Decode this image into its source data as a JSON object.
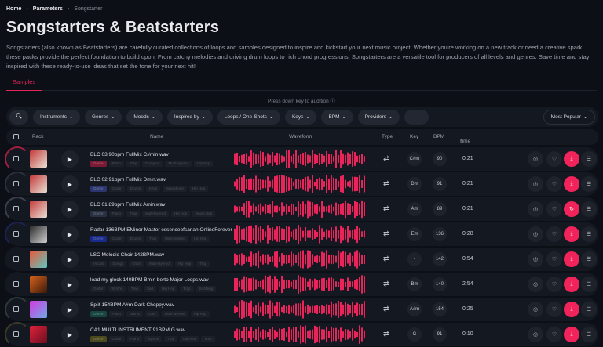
{
  "breadcrumb": [
    "Home",
    "Parameters",
    "Songstarter"
  ],
  "title": "Songstarters & Beatstarters",
  "description": "Songstarters (also known as Beatstarters) are carefully curated collections of loops and samples designed to inspire and kickstart your next music project. Whether you're working on a new track or need a creative spark, these packs provide the perfect foundation to build upon. From catchy melodies and driving drum loops to rich chord progressions, Songstarters are a versatile tool for producers of all levels and genres. Save time and stay inspired with these ready-to-use ideas that set the tone for your next hit!",
  "tabs": [
    {
      "label": "Samples",
      "active": true
    }
  ],
  "hint": "Press down key to audition",
  "filters": [
    "Instruments",
    "Genres",
    "Moods",
    "Inspired by",
    "Loops / One-Shots",
    "Keys",
    "BPM",
    "Providers"
  ],
  "more_label": "···",
  "sort": "Most Popular",
  "columns": {
    "pack": "Pack",
    "name": "Name",
    "waveform": "Waveform",
    "type": "Type",
    "key": "Key",
    "bpm": "BPM",
    "time": "Time"
  },
  "accent": "#f0245b",
  "rows": [
    {
      "name": "BLC 03 90bpm FullMix C#min.wav",
      "tags": [
        "Genre",
        "Piano",
        "Trap",
        "Dungeon",
        "Multi-layered",
        "Hip Hop"
      ],
      "badge_color": "#7a1a34",
      "ring": "#a01e40",
      "key": "C#m",
      "bpm": "90",
      "time": "0:21",
      "art": [
        "#c43a3a",
        "#e8e1d5"
      ],
      "action": "download"
    },
    {
      "name": "BLC 02 91bpm FullMix Dmin.wav",
      "tags": [
        "Genre",
        "Guitar",
        "Drums",
        "Keys",
        "Saxophone",
        "Hip Hop"
      ],
      "badge_color": "#2b3670",
      "ring": "#2a2f3a",
      "key": "Dm",
      "bpm": "91",
      "time": "0:21",
      "art": [
        "#c43a3a",
        "#e8e1d5"
      ],
      "action": "download"
    },
    {
      "name": "BLC 01 89bpm FullMix Amin.wav",
      "tags": [
        "Genre",
        "Piano",
        "Trap",
        "Multi-layered",
        "Hip Hop",
        "Boom Bap"
      ],
      "badge_color": "#283042",
      "ring": "#3a3f4a",
      "key": "Am",
      "bpm": "89",
      "time": "0:21",
      "art": [
        "#c43a3a",
        "#e8e1d5"
      ],
      "action": "replay"
    },
    {
      "name": "Radar 136BPM EMinor Master essenceofsariah OnlineForeverM",
      "tags": [
        "Genre",
        "Guitar",
        "Drums",
        "Trap",
        "Multi-layered",
        "Hip Hop"
      ],
      "badge_color": "#1a2a8a",
      "ring": "#1b2250",
      "key": "Em",
      "bpm": "136",
      "time": "0:28",
      "art": [
        "#2a2a2a",
        "#cfcfcf"
      ],
      "action": "download"
    },
    {
      "name": "LSC Melodic Choir 142BPM.wav",
      "tags": [
        "Vocals",
        "Strings",
        "Choir",
        "Multi-layered",
        "Hip Hop",
        "Trap"
      ],
      "badge_color": "#1c2029",
      "ring": "#141821",
      "key": "-",
      "bpm": "142",
      "time": "0:54",
      "art": [
        "#e8583a",
        "#5fc6c0"
      ],
      "action": "download"
    },
    {
      "name": "load my glock 140BPM Bmin berto Major Loops.wav",
      "tags": [
        "Guitar",
        "Synths",
        "Trap",
        "Sad",
        "Hip Hop",
        "Trap",
        "Soothing"
      ],
      "badge_color": "#1c2029",
      "ring": "#141821",
      "key": "Bm",
      "bpm": "140",
      "time": "2:54",
      "art": [
        "#d8621c",
        "#3a1a0a"
      ],
      "action": "download"
    },
    {
      "name": "Split 154BPM A#m Dark Choppy.wav",
      "tags": [
        "Genre",
        "Piano",
        "Drums",
        "Dark",
        "Multi-layered",
        "Hip Hop"
      ],
      "badge_color": "#17463f",
      "ring": "#2d3a38",
      "key": "A#m",
      "bpm": "154",
      "time": "0:25",
      "art": [
        "#d43adf",
        "#6fa8e8"
      ],
      "action": "download"
    },
    {
      "name": "CA1 MULTI INSTRUMENT 91BPM G.wav",
      "tags": [
        "Genre",
        "Guitar",
        "Piano",
        "Synths",
        "Trap",
        "Layered",
        "Trap"
      ],
      "badge_color": "#4a4a1c",
      "ring": "#3a3a28",
      "key": "G",
      "bpm": "91",
      "time": "0:10",
      "art": [
        "#e0203a",
        "#6a1020"
      ],
      "action": "download"
    }
  ]
}
